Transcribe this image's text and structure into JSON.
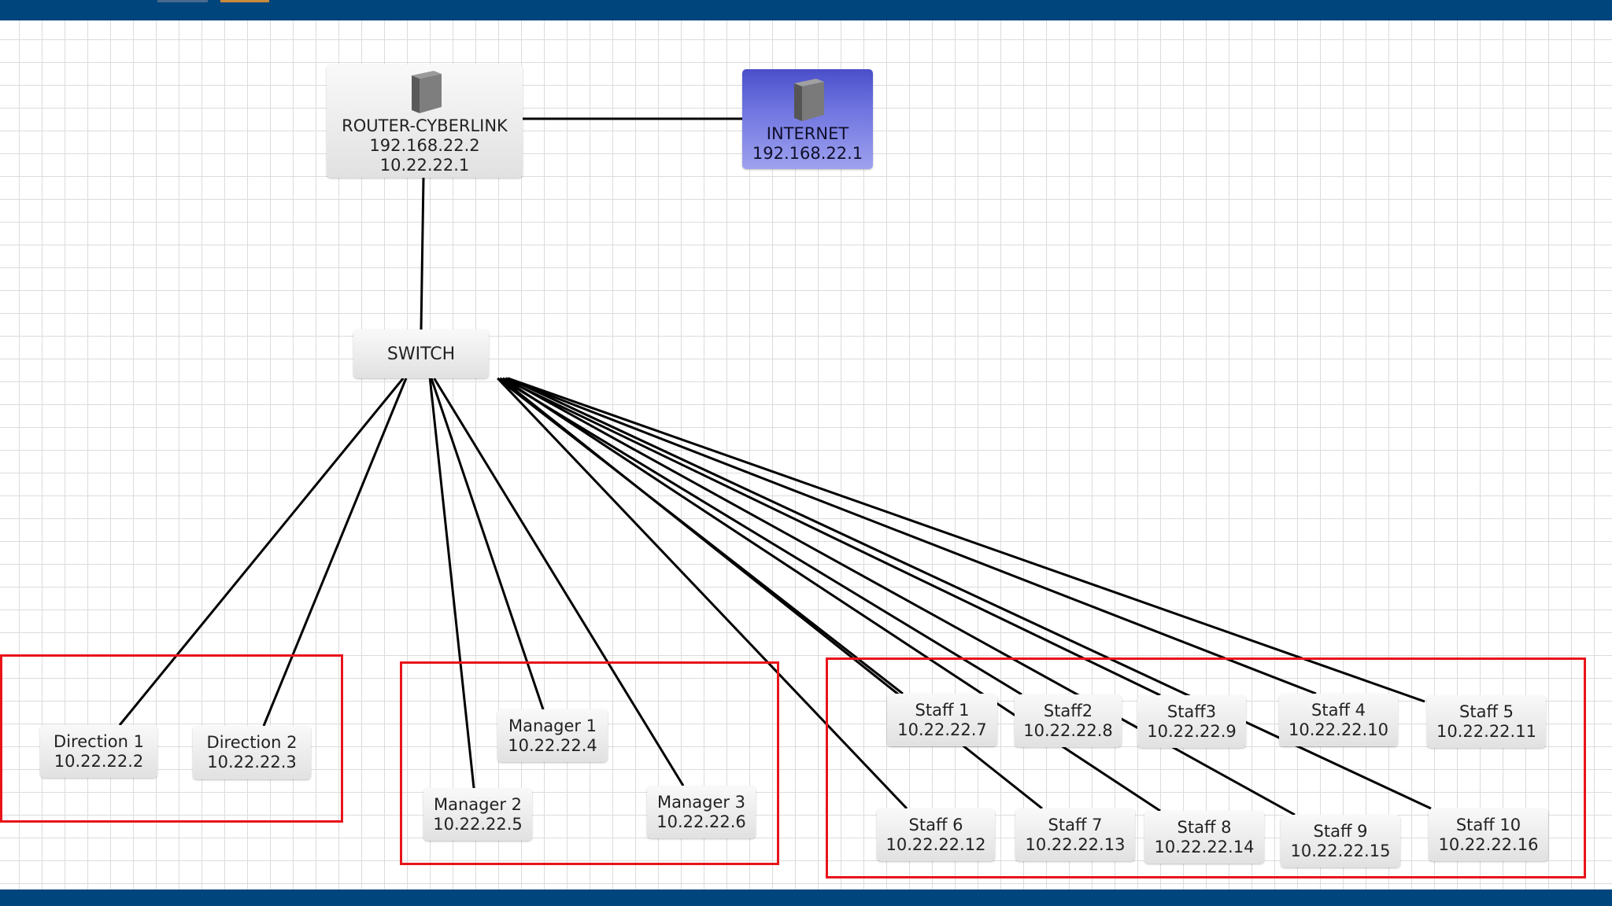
{
  "nodes": {
    "router": {
      "name": "ROUTER-CYBERLINK",
      "ip1": "192.168.22.2",
      "ip2": "10.22.22.1",
      "icon": "router-device-icon"
    },
    "internet": {
      "name": "INTERNET",
      "ip": "192.168.22.1",
      "icon": "router-device-icon"
    },
    "switch": {
      "name": "SWITCH"
    },
    "direction1": {
      "name": "Direction 1",
      "ip": "10.22.22.2"
    },
    "direction2": {
      "name": "Direction 2",
      "ip": "10.22.22.3"
    },
    "manager1": {
      "name": "Manager 1",
      "ip": "10.22.22.4"
    },
    "manager2": {
      "name": "Manager 2",
      "ip": "10.22.22.5"
    },
    "manager3": {
      "name": "Manager 3",
      "ip": "10.22.22.6"
    },
    "staff1": {
      "name": "Staff 1",
      "ip": "10.22.22.7"
    },
    "staff2": {
      "name": "Staff2",
      "ip": "10.22.22.8"
    },
    "staff3": {
      "name": "Staff3",
      "ip": "10.22.22.9"
    },
    "staff4": {
      "name": "Staff 4",
      "ip": "10.22.22.10"
    },
    "staff5": {
      "name": "Staff 5",
      "ip": "10.22.22.11"
    },
    "staff6": {
      "name": "Staff 6",
      "ip": "10.22.22.12"
    },
    "staff7": {
      "name": "Staff 7",
      "ip": "10.22.22.13"
    },
    "staff8": {
      "name": "Staff 8",
      "ip": "10.22.22.14"
    },
    "staff9": {
      "name": "Staff 9",
      "ip": "10.22.22.15"
    },
    "staff10": {
      "name": "Staff 10",
      "ip": "10.22.22.16"
    }
  },
  "links": [
    [
      "router",
      "internet"
    ],
    [
      "router",
      "switch"
    ],
    [
      "switch",
      "direction1"
    ],
    [
      "switch",
      "direction2"
    ],
    [
      "switch",
      "manager1"
    ],
    [
      "switch",
      "manager2"
    ],
    [
      "switch",
      "manager3"
    ],
    [
      "switch",
      "staff1"
    ],
    [
      "switch",
      "staff2"
    ],
    [
      "switch",
      "staff3"
    ],
    [
      "switch",
      "staff4"
    ],
    [
      "switch",
      "staff5"
    ],
    [
      "switch",
      "staff6"
    ],
    [
      "switch",
      "staff7"
    ],
    [
      "switch",
      "staff8"
    ],
    [
      "switch",
      "staff9"
    ],
    [
      "switch",
      "staff10"
    ]
  ],
  "colors": {
    "frame": "#00457c",
    "group_border": "#e8141a",
    "link": "#000000",
    "internet_fill": "#5a5fd6"
  }
}
